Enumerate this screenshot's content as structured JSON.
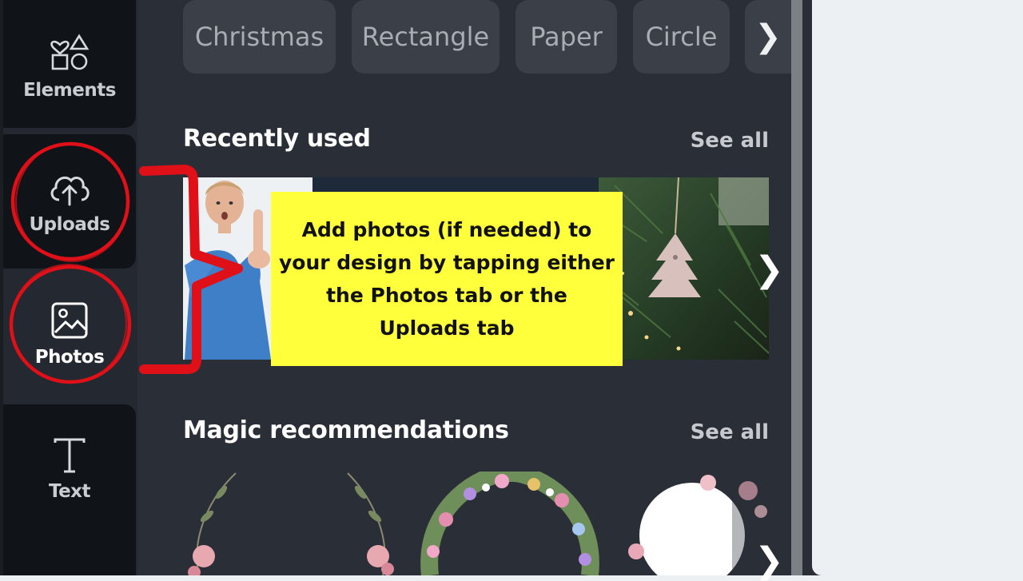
{
  "sidebar": {
    "items": [
      {
        "label": "Elements",
        "icon": "elements-icon"
      },
      {
        "label": "Uploads",
        "icon": "cloud-upload-icon"
      },
      {
        "label": "Photos",
        "icon": "image-icon"
      },
      {
        "label": "Text",
        "icon": "text-icon"
      }
    ]
  },
  "chips": [
    "Christmas",
    "Rectangle",
    "Paper",
    "Circle"
  ],
  "sections": {
    "recent": {
      "title": "Recently used",
      "see_all": "See all"
    },
    "magic": {
      "title": "Magic recommendations",
      "see_all": "See all"
    }
  },
  "callout": {
    "lines": [
      "Add photos (if needed) to",
      "your design by tapping either",
      "the Photos tab or the",
      "Uploads tab"
    ]
  },
  "colors": {
    "panel": "#2a2e37",
    "rail": "#242830",
    "chip": "#3a3f48",
    "callout": "#ffff3b",
    "annotation": "#e01018"
  }
}
